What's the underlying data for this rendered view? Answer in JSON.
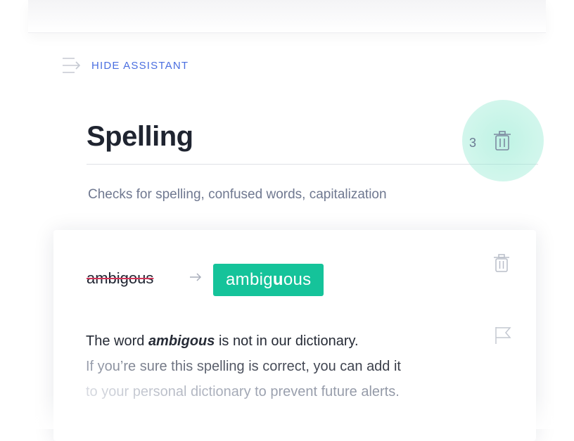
{
  "assistant": {
    "hide_label": "HIDE ASSISTANT"
  },
  "category": {
    "title": "Spelling",
    "count": "3",
    "description": "Checks for spelling, confused words, capitalization"
  },
  "card": {
    "original_word": "ambigous",
    "suggestion_prefix": "ambig",
    "suggestion_highlight": "u",
    "suggestion_suffix": "ous",
    "explanation": {
      "prefix": "The word ",
      "word": "ambigous",
      "suffix": " is not in our dictionary.",
      "line2": "If you’re sure this spelling is correct, you can add it",
      "line3": "to your personal dictionary to prevent future alerts."
    }
  },
  "colors": {
    "accent_blue": "#4a6ee0",
    "suggestion_green": "#15c39a",
    "strike_red": "#d4365a",
    "highlight_mint": "#8ae8ce"
  },
  "icons": {
    "hide_assistant": "collapse-arrow-icon",
    "trash": "trash-icon",
    "arrow": "arrow-right-icon",
    "flag": "flag-icon"
  }
}
